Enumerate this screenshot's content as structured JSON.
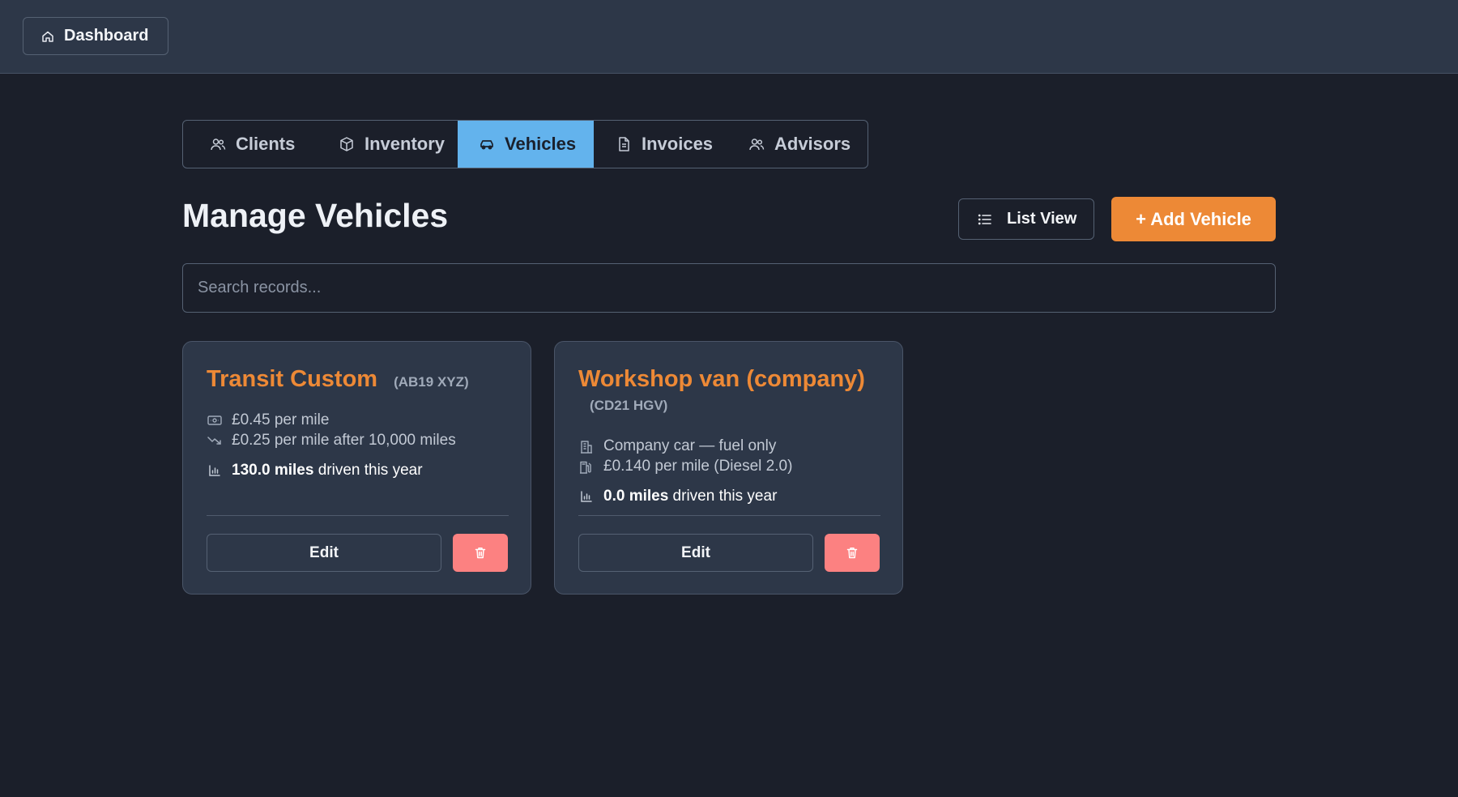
{
  "header": {
    "dashboard_label": "Dashboard"
  },
  "tabs": [
    {
      "label": "Clients",
      "icon": "users-icon"
    },
    {
      "label": "Inventory",
      "icon": "box-icon"
    },
    {
      "label": "Vehicles",
      "icon": "car-icon",
      "active": true
    },
    {
      "label": "Invoices",
      "icon": "document-icon"
    },
    {
      "label": "Advisors",
      "icon": "users-icon"
    }
  ],
  "page": {
    "title": "Manage Vehicles",
    "list_view_label": "List View",
    "add_label": "+ Add Vehicle",
    "search_placeholder": "Search records..."
  },
  "vehicles": [
    {
      "name": "Transit Custom",
      "reg": "(AB19 XYZ)",
      "line1": "£0.45 per mile",
      "line1_icon": "banknote-icon",
      "line2": "£0.25 per mile after 10,000 miles",
      "line2_icon": "trending-down-icon",
      "miles_value": "130.0 miles",
      "miles_suffix": " driven this year",
      "edit_label": "Edit"
    },
    {
      "name": "Workshop van (company)",
      "reg": "(CD21 HGV)",
      "line1": "Company car — fuel only",
      "line1_icon": "building-icon",
      "line2": "£0.140 per mile (Diesel 2.0)",
      "line2_icon": "fuel-icon",
      "miles_value": "0.0 miles",
      "miles_suffix": " driven this year",
      "edit_label": "Edit"
    }
  ],
  "colors": {
    "background": "#1b1f2a",
    "surface": "#2d3748",
    "accent_orange": "#ed8936",
    "active_tab": "#63b3ed",
    "delete": "#fc8181"
  }
}
